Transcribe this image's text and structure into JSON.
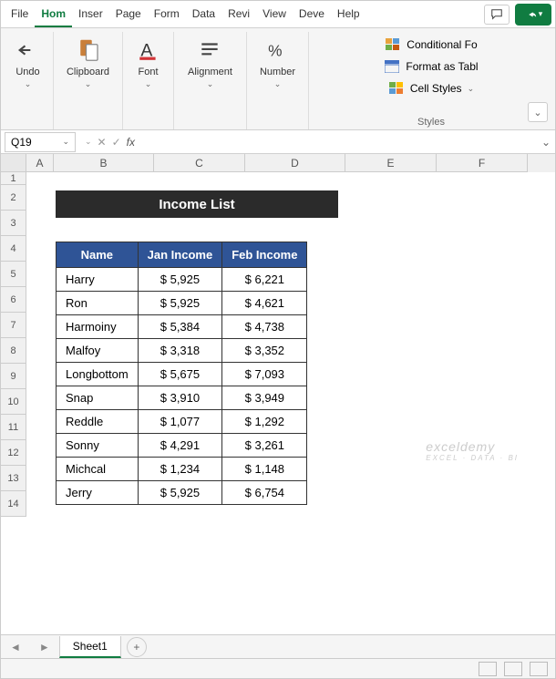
{
  "menu": {
    "tabs": [
      "File",
      "Hom",
      "Inser",
      "Page",
      "Form",
      "Data",
      "Revi",
      "View",
      "Deve",
      "Help"
    ],
    "active_index": 1
  },
  "ribbon": {
    "undo": "Undo",
    "clipboard": "Clipboard",
    "font": "Font",
    "alignment": "Alignment",
    "number": "Number",
    "styles_label": "Styles",
    "cond_format": "Conditional Fo",
    "format_table": "Format as Tabl",
    "cell_styles": "Cell Styles"
  },
  "fx": {
    "namebox": "Q19",
    "formula": ""
  },
  "columns": [
    {
      "letter": "A",
      "width": 30
    },
    {
      "letter": "B",
      "width": 110
    },
    {
      "letter": "C",
      "width": 100
    },
    {
      "letter": "D",
      "width": 110
    },
    {
      "letter": "E",
      "width": 100
    },
    {
      "letter": "F",
      "width": 100
    }
  ],
  "rows": [
    "1",
    "2",
    "3",
    "4",
    "5",
    "6",
    "7",
    "8",
    "9",
    "10",
    "11",
    "12",
    "13",
    "14"
  ],
  "title": "Income List",
  "table": {
    "headers": [
      "Name",
      "Jan Income",
      "Feb Income"
    ],
    "rows": [
      {
        "name": "Harry",
        "jan": "$ 5,925",
        "feb": "$ 6,221"
      },
      {
        "name": "Ron",
        "jan": "$ 5,925",
        "feb": "$ 4,621"
      },
      {
        "name": "Harmoiny",
        "jan": "$ 5,384",
        "feb": "$ 4,738"
      },
      {
        "name": "Malfoy",
        "jan": "$ 3,318",
        "feb": "$ 3,352"
      },
      {
        "name": "Longbottom",
        "jan": "$ 5,675",
        "feb": "$ 7,093"
      },
      {
        "name": "Snap",
        "jan": "$ 3,910",
        "feb": "$ 3,949"
      },
      {
        "name": "Reddle",
        "jan": "$ 1,077",
        "feb": "$ 1,292"
      },
      {
        "name": "Sonny",
        "jan": "$ 4,291",
        "feb": "$ 3,261"
      },
      {
        "name": "Michcal",
        "jan": "$ 1,234",
        "feb": "$ 1,148"
      },
      {
        "name": "Jerry",
        "jan": "$ 5,925",
        "feb": "$ 6,754"
      }
    ]
  },
  "sheet": {
    "name": "Sheet1"
  },
  "watermark": {
    "main": "exceldemy",
    "sub": "EXCEL · DATA · BI"
  }
}
